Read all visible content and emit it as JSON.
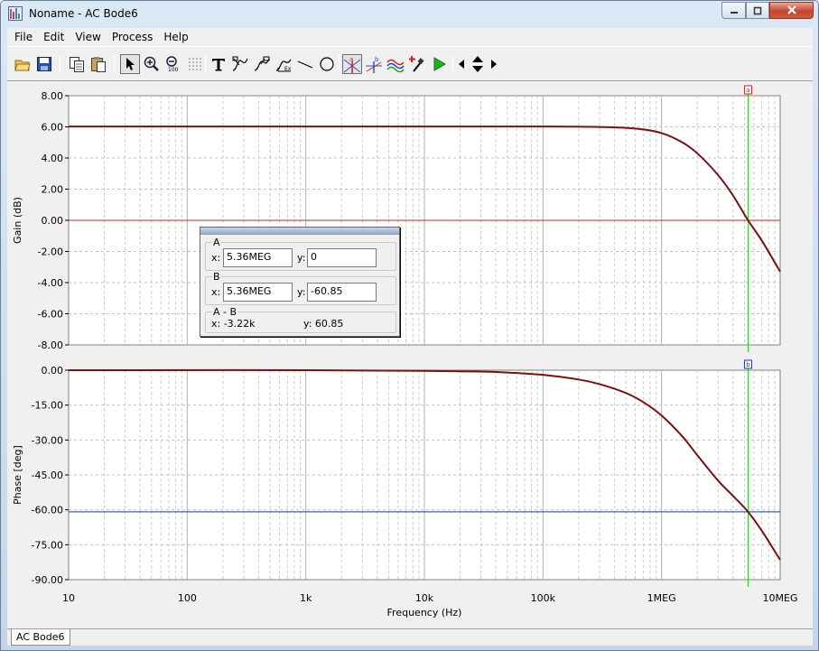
{
  "window": {
    "title": "Noname - AC Bode6"
  },
  "menu": [
    "File",
    "Edit",
    "View",
    "Process",
    "Help"
  ],
  "toolbar_icons": [
    "open-folder-icon",
    "save-disk-icon",
    "copy-icon",
    "paste-icon",
    "pointer-icon",
    "zoom-in-icon",
    "zoom-out-icon",
    "grid-dots-icon",
    "text-tool-icon",
    "curve-label-icon",
    "curve-label-2-icon",
    "axis-label-icon",
    "line-tool-icon",
    "circle-tool-icon",
    "cursor-a-icon",
    "cursor-b-icon",
    "waveforms-icon",
    "add-marker-icon",
    "run-icon",
    "nav-left-icon",
    "nav-updown-icon",
    "nav-right-icon"
  ],
  "cursor_panel": {
    "a": {
      "title": "A",
      "x_label": "x:",
      "x_value": "5.36MEG",
      "y_label": "y:",
      "y_value": "0"
    },
    "b": {
      "title": "B",
      "x_label": "x:",
      "x_value": "5.36MEG",
      "y_label": "y:",
      "y_value": "-60.85"
    },
    "diff": {
      "title": "A - B",
      "x_text": "x:   -3.22k",
      "y_text": "y: 60.85"
    }
  },
  "status_tab": "AC Bode6",
  "chart_data": [
    {
      "type": "line",
      "ylabel": "Gain (dB)",
      "ylim": [
        -8,
        8
      ],
      "yticks": [
        8,
        6,
        4,
        2,
        0,
        -2,
        -4,
        -6,
        -8
      ],
      "ytick_labels": [
        "8.00",
        "6.00",
        "4.00",
        "2.00",
        "0.00",
        "-2.00",
        "-4.00",
        "-6.00",
        "-8.00"
      ],
      "xscale": "log",
      "xlim": [
        10,
        10000000
      ],
      "grid": true,
      "series_color": "#7b1010",
      "x": [
        10,
        100,
        1000,
        10000,
        100000,
        300000,
        600000,
        1000000,
        1500000,
        2000000,
        3000000,
        4000000,
        5360000,
        7000000,
        10000000
      ],
      "y": [
        6.02,
        6.02,
        6.02,
        6.02,
        6.02,
        5.99,
        5.89,
        5.6,
        5.0,
        4.3,
        2.9,
        1.6,
        0,
        -1.3,
        -3.3
      ],
      "cursor_a": {
        "x": 5360000,
        "y": 0,
        "color": "#cc2020",
        "marker": "a"
      }
    },
    {
      "type": "line",
      "xlabel": "Frequency (Hz)",
      "ylabel": "Phase [deg]",
      "ylim": [
        -90,
        0
      ],
      "yticks": [
        0,
        -15,
        -30,
        -45,
        -60,
        -75,
        -90
      ],
      "ytick_labels": [
        "0.00",
        "-15.00",
        "-30.00",
        "-45.00",
        "-60.00",
        "-75.00",
        "-90.00"
      ],
      "xscale": "log",
      "xlim": [
        10,
        10000000
      ],
      "xticks": [
        10,
        100,
        1000,
        10000,
        100000,
        1000000,
        10000000
      ],
      "xtick_labels": [
        "10",
        "100",
        "1k",
        "10k",
        "100k",
        "1MEG",
        "10MEG"
      ],
      "grid": true,
      "series_color": "#7b1010",
      "x": [
        10,
        1000,
        10000,
        30000,
        50000,
        100000,
        200000,
        300000,
        500000,
        700000,
        1000000,
        1500000,
        2000000,
        3000000,
        4000000,
        5360000,
        7000000,
        10000000
      ],
      "y": [
        0,
        0,
        -0.3,
        -0.6,
        -1.0,
        -2.0,
        -4.0,
        -6.0,
        -9.8,
        -13.7,
        -19.5,
        -28.5,
        -36.5,
        -47.5,
        -54.0,
        -60.85,
        -69.0,
        -81.5
      ],
      "cursor_b": {
        "x": 5360000,
        "y": -60.85,
        "color": "#2030a0",
        "marker": "b"
      }
    }
  ]
}
